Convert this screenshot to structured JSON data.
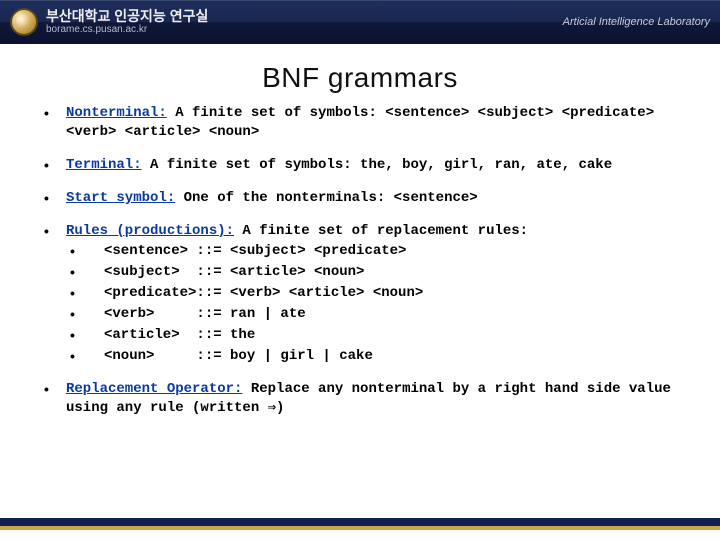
{
  "header": {
    "title_ko": "부산대학교 인공지능 연구실",
    "subtitle": "borame.cs.pusan.ac.kr",
    "right_label": "Articial Intelligence Laboratory"
  },
  "slide": {
    "title": "BNF grammars"
  },
  "items": {
    "nonterminal_label": "Nonterminal:",
    "nonterminal_text": " A finite set of symbols: <sentence> <subject> <predicate> <verb> <article> <noun>",
    "terminal_label": "Terminal:",
    "terminal_text": " A finite set of symbols: the, boy, girl, ran, ate, cake",
    "start_label": "Start symbol:",
    "start_text": " One of the nonterminals: <sentence>",
    "rules_label": "Rules (productions):",
    "rules_text": " A finite set of replacement rules:",
    "rule1": "<sentence> ::= <subject> <predicate>",
    "rule2": "<subject>  ::= <article> <noun>",
    "rule3": "<predicate>::= <verb> <article> <noun>",
    "rule4": "<verb>     ::= ran | ate",
    "rule5": "<article>  ::= the",
    "rule6": "<noun>     ::= boy | girl | cake",
    "replace_label": "Replacement Operator:",
    "replace_text": " Replace any nonterminal by a right hand side value using any rule (written ⇒)"
  }
}
